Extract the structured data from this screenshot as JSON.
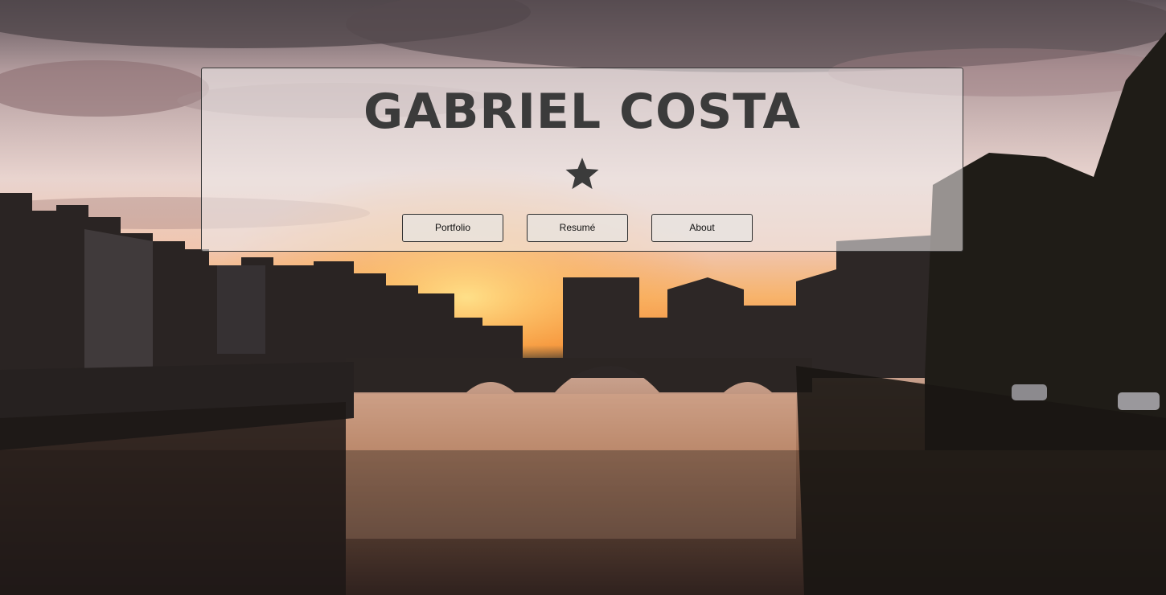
{
  "header": {
    "title": "Gabriel Costa",
    "decoration_icon": "star-icon"
  },
  "nav": {
    "items": [
      {
        "label": "Portfolio"
      },
      {
        "label": "Resumé"
      },
      {
        "label": "About"
      }
    ]
  },
  "colors": {
    "title": "#3b3b3b",
    "card_background": "#eee8e8",
    "button_border": "#2f2f2f"
  }
}
